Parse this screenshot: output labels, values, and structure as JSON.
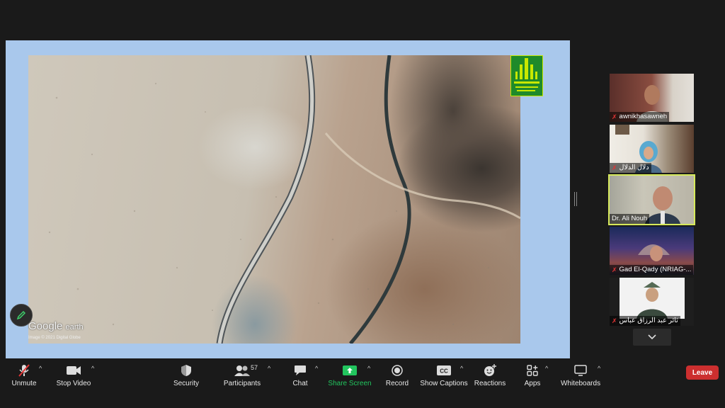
{
  "shared_screen": {
    "watermark_brand": "Google",
    "watermark_product": "earth",
    "watermark_credit": "Image © 2021 Digital Globe"
  },
  "participants": [
    {
      "name": "awnikhasawneh",
      "muted": true,
      "active": false
    },
    {
      "name": "دلال الدلال",
      "muted": true,
      "active": false
    },
    {
      "name": "Dr. Ali Nouh",
      "muted": false,
      "active": true
    },
    {
      "name": "Gad El-Qady (NRIAG-...",
      "muted": true,
      "active": false
    },
    {
      "name": "ثائر عبد الرزاق عباس",
      "muted": true,
      "active": false
    }
  ],
  "toolbar": {
    "unmute": "Unmute",
    "stop_video": "Stop Video",
    "security": "Security",
    "participants": "Participants",
    "participants_count": "57",
    "chat": "Chat",
    "share_screen": "Share Screen",
    "record": "Record",
    "show_captions": "Show Captions",
    "reactions": "Reactions",
    "apps": "Apps",
    "whiteboards": "Whiteboards",
    "leave": "Leave"
  },
  "colors": {
    "share_border": "#a9c8ec",
    "active_speaker": "#d6e95b",
    "share_green": "#22c55e",
    "leave_red": "#cc2f2f"
  }
}
